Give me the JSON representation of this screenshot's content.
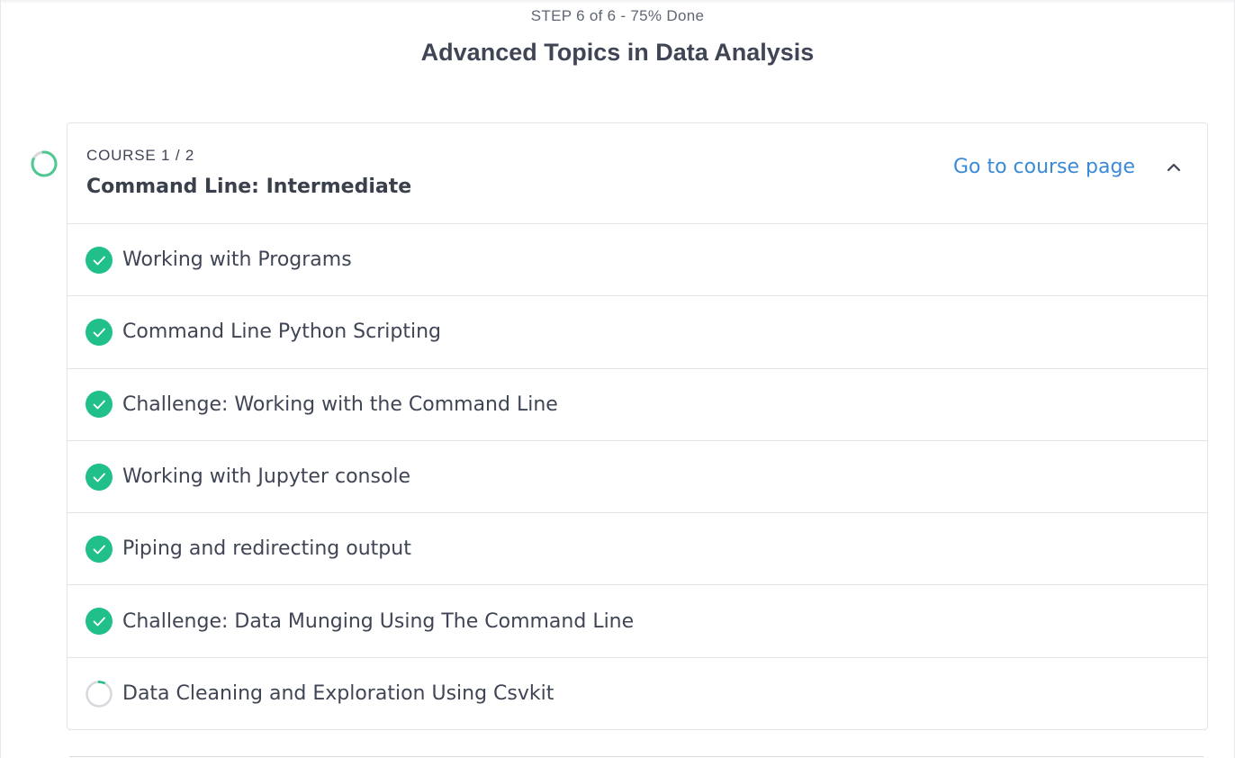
{
  "step": {
    "progress_label": "STEP 6 of 6 - 75% Done",
    "title": "Advanced Topics in Data Analysis"
  },
  "course": {
    "counter": "COURSE 1 / 2",
    "title": "Command Line: Intermediate",
    "link_label": "Go to course page",
    "expanded": true,
    "progress_icon": "partial-progress-ring-icon"
  },
  "lessons": [
    {
      "label": "Working with Programs",
      "status": "completed",
      "icon": "check-circle-icon"
    },
    {
      "label": "Command Line Python Scripting",
      "status": "completed",
      "icon": "check-circle-icon"
    },
    {
      "label": "Challenge: Working with the Command Line",
      "status": "completed",
      "icon": "check-circle-icon"
    },
    {
      "label": "Working with Jupyter console",
      "status": "completed",
      "icon": "check-circle-icon"
    },
    {
      "label": "Piping and redirecting output",
      "status": "completed",
      "icon": "check-circle-icon"
    },
    {
      "label": "Challenge: Data Munging Using The Command Line",
      "status": "completed",
      "icon": "check-circle-icon"
    },
    {
      "label": "Data Cleaning and Exploration Using Csvkit",
      "status": "in-progress",
      "icon": "in-progress-ring-icon"
    }
  ],
  "colors": {
    "accent_green": "#21c08b",
    "link_blue": "#3b8ad8",
    "ring_gray": "#d5d8dd",
    "text_dark": "#3f4554"
  }
}
